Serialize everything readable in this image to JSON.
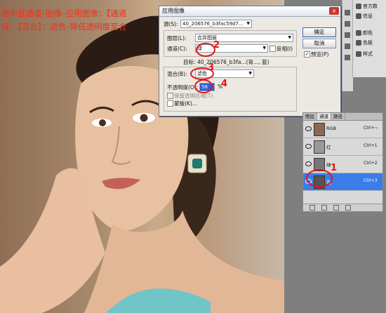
{
  "instruction": {
    "line1": "选中蓝通道–图像–应用图像：【通道",
    "line2": "绿–【混合】：滤色–降低透明度至合"
  },
  "dialog": {
    "title": "应用图像",
    "close_label": "×",
    "source_label": "源(S):",
    "source_value": "40_206576_b3fac59d7...",
    "layer_label": "图层(L):",
    "layer_value": "合并图层",
    "channel_label": "通道(C):",
    "channel_value": "绿",
    "invert_label": "反相(I)",
    "target_label": "目标:",
    "target_value": "40_206576_b3fa...(背..., 蓝)",
    "blend_group_label": "混合(B):",
    "blend_value": "滤色",
    "opacity_label": "不透明度(O):",
    "opacity_value": "58",
    "opacity_unit": "%",
    "preserve_label": "保留透明区域(T)",
    "mask_label": "蒙版(K)...",
    "ok_label": "确定",
    "cancel_label": "取消",
    "preview_label": "预览(P)"
  },
  "annotations": [
    "1",
    "2",
    "3",
    "4"
  ],
  "right_panels": {
    "items": [
      {
        "label": "官方数",
        "icon": "document-icon"
      },
      {
        "label": "信息",
        "icon": "info-icon"
      },
      {
        "label": "颜色",
        "icon": "palette-icon"
      },
      {
        "label": "色板",
        "icon": "swatches-icon"
      },
      {
        "label": "样式",
        "icon": "styles-icon"
      }
    ]
  },
  "channels_panel": {
    "tabs": [
      "图层",
      "通道",
      "路径"
    ],
    "active_tab": "通道",
    "rows": [
      {
        "name": "RGB",
        "shortcut": "Ctrl+~"
      },
      {
        "name": "红",
        "shortcut": "Ctrl+1"
      },
      {
        "name": "绿",
        "shortcut": "Ctrl+2"
      },
      {
        "name": "蓝",
        "shortcut": "Ctrl+3"
      }
    ]
  },
  "colors": {
    "annotation_red": "#e0161b",
    "selected_row": "#3b7de8"
  }
}
